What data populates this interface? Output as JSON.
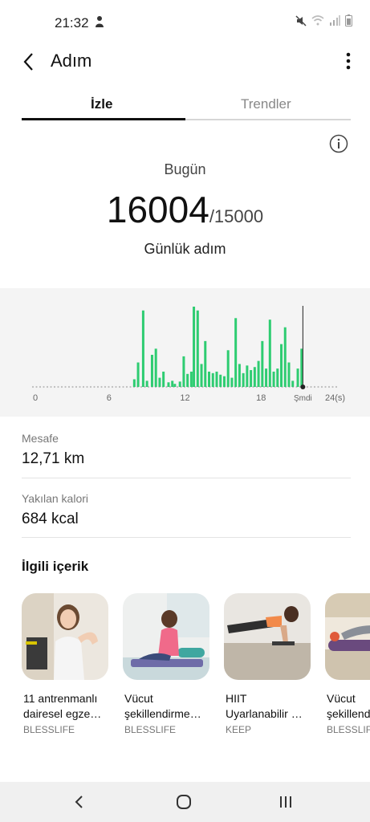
{
  "status": {
    "time": "21:32"
  },
  "appbar": {
    "title": "Adım",
    "back_icon": "back-arrow-icon",
    "more_icon": "more-vert-icon"
  },
  "tabs": [
    {
      "label": "İzle",
      "active": true
    },
    {
      "label": "Trendler",
      "active": false
    }
  ],
  "today": {
    "label": "Bugün",
    "steps": "16004",
    "goal": "/15000",
    "caption": "Günlük adım"
  },
  "chart_data": {
    "type": "bar",
    "x_ticks": [
      "0",
      "6",
      "12",
      "18",
      "Şmdi",
      "24(s)"
    ],
    "x_unit": "hour",
    "xlim": [
      0,
      24
    ],
    "now_hour": 21.3,
    "bar_color": "#2ecc71",
    "hours": [
      8.0,
      8.3,
      8.7,
      9.0,
      9.4,
      9.7,
      10.0,
      10.3,
      10.7,
      11.0,
      11.2,
      11.6,
      11.9,
      12.2,
      12.5,
      12.7,
      13.0,
      13.3,
      13.6,
      13.9,
      14.2,
      14.5,
      14.8,
      15.1,
      15.4,
      15.7,
      16.0,
      16.3,
      16.6,
      16.9,
      17.2,
      17.5,
      17.8,
      18.1,
      18.4,
      18.7,
      19.0,
      19.3,
      19.6,
      19.9,
      20.2,
      20.5,
      20.9,
      21.2
    ],
    "values": [
      10,
      32,
      100,
      8,
      42,
      50,
      12,
      20,
      6,
      8,
      4,
      7,
      40,
      17,
      20,
      105,
      100,
      30,
      60,
      20,
      18,
      20,
      16,
      14,
      48,
      12,
      90,
      30,
      18,
      28,
      22,
      26,
      34,
      60,
      24,
      88,
      20,
      24,
      56,
      78,
      32,
      8,
      24,
      50
    ]
  },
  "stats": [
    {
      "label": "Mesafe",
      "value": "12,71 km"
    },
    {
      "label": "Yakılan kalori",
      "value": "684 kcal"
    }
  ],
  "related": {
    "title": "İlgili içerik",
    "cards": [
      {
        "title": "11 antrenmanlı\ndairesel egze…",
        "source": "BLESSLIFE"
      },
      {
        "title": "Vücut\nşekillendirme…",
        "source": "BLESSLIFE"
      },
      {
        "title": "HIIT\nUyarlanabilir …",
        "source": "KEEP"
      },
      {
        "title": "Vücut\nşekillendirme",
        "source": "BLESSLIFE"
      }
    ]
  },
  "colors": {
    "accent": "#2ecc71",
    "tab_active": "#111111",
    "muted": "#777777"
  }
}
